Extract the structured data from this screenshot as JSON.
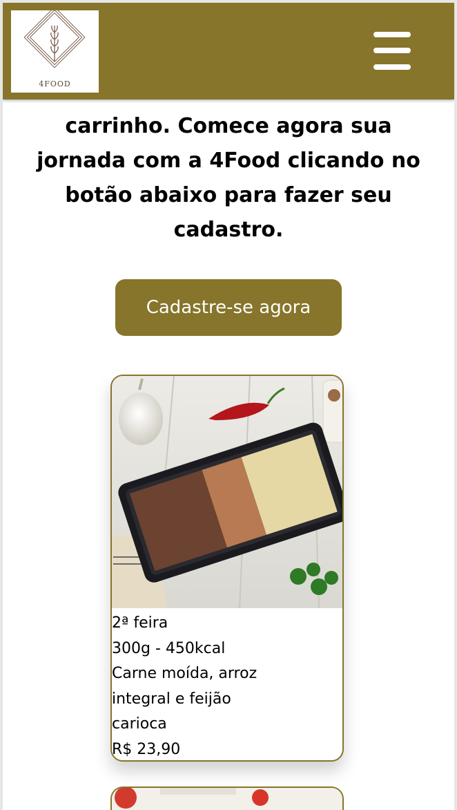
{
  "header": {
    "logo_text": "4FOOD",
    "menu_icon": "hamburger-menu-icon",
    "brand_color": "#86752a"
  },
  "intro": {
    "text": "carrinho. Comece agora sua jornada com a 4Food clicando no botão abaixo para fazer seu cadastro."
  },
  "cta": {
    "label": "Cadastre-se agora"
  },
  "cards": [
    {
      "image": "meal-tray-photo",
      "day": "2ª feira",
      "nutrition": "300g - 450kcal",
      "description_line1": "Carne moída, arroz",
      "description_line2": "integral e feijão",
      "description_line3": "carioca",
      "price": "R$ 23,90"
    },
    {
      "image": "meal-photo"
    }
  ]
}
